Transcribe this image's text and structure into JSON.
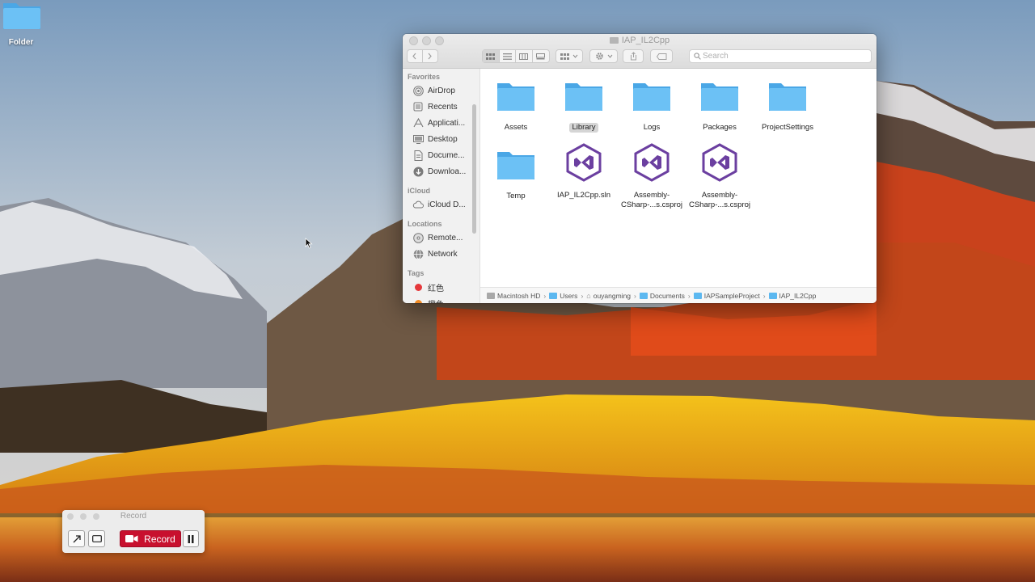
{
  "desktop": {
    "folder_label": "Folder"
  },
  "finder": {
    "title": "IAP_IL2Cpp",
    "search_placeholder": "Search",
    "sidebar": {
      "favorites_header": "Favorites",
      "favorites": [
        "AirDrop",
        "Recents",
        "Applicati...",
        "Desktop",
        "Docume...",
        "Downloa..."
      ],
      "icloud_header": "iCloud",
      "icloud": [
        "iCloud D..."
      ],
      "locations_header": "Locations",
      "locations": [
        "Remote...",
        "Network"
      ],
      "tags_header": "Tags",
      "tags": [
        "红色",
        "橙色"
      ],
      "tag_colors": [
        "#e5383b",
        "#f08a24"
      ]
    },
    "files": [
      {
        "name": "Assets",
        "kind": "folder",
        "selected": false
      },
      {
        "name": "Library",
        "kind": "folder",
        "selected": true
      },
      {
        "name": "Logs",
        "kind": "folder",
        "selected": false
      },
      {
        "name": "Packages",
        "kind": "folder",
        "selected": false
      },
      {
        "name": "ProjectSettings",
        "kind": "folder",
        "selected": false
      },
      {
        "name": "Temp",
        "kind": "folder",
        "selected": false
      },
      {
        "name": "IAP_IL2Cpp.sln",
        "kind": "visual-studio",
        "selected": false
      },
      {
        "name": "Assembly-\nCSharp-...s.csproj",
        "kind": "visual-studio",
        "selected": false
      },
      {
        "name": "Assembly-\nCSharp-...s.csproj",
        "kind": "visual-studio",
        "selected": false
      }
    ],
    "path": [
      "Macintosh HD",
      "Users",
      "ouyangming",
      "Documents",
      "IAPSampleProject",
      "IAP_IL2Cpp"
    ]
  },
  "recorder": {
    "title": "Record",
    "record_label": "Record",
    "accent": "#c8102e"
  },
  "colors": {
    "folder": "#5cb8f0",
    "vs_purple": "#6b3fa0"
  }
}
